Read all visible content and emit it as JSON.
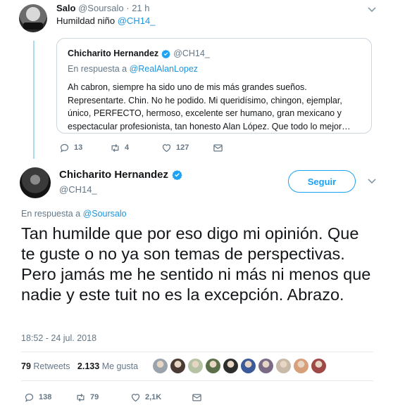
{
  "reply_tweet": {
    "author_name": "Salo",
    "author_handle": "@Soursalo",
    "age": "21 h",
    "text_prefix": "Humildad niño",
    "text_mention": "@CH14_",
    "actions": {
      "replies": "13",
      "retweets": "4",
      "likes": "127"
    }
  },
  "quoted_tweet": {
    "author_name": "Chicharito Hernandez",
    "author_handle": "@CH14_",
    "in_reply_label": "En respuesta a",
    "in_reply_mention": "@RealAlanLopez",
    "text": "Ah cabron, siempre ha sido uno de mis más grandes sueños. Representarte. Chin. No he podido. Mi queridísimo, chingon, ejemplar, único, PERFECTO, hermoso, excelente ser humano, gran mexicano y espectacular profesionista, tan honesto Alan López. Que todo lo mejor…"
  },
  "main_tweet": {
    "author_name": "Chicharito Hernandez",
    "author_handle": "@CH14_",
    "follow_label": "Seguir",
    "in_reply_label": "En respuesta a",
    "in_reply_mention": "@Soursalo",
    "text": "Tan humilde que por eso digo mi opinión. Que te guste o no ya son temas de perspectivas. Pero jamás me he sentido ni más ni menos que nadie y este tuit no es la excepción. Abrazo.",
    "timestamp": "18:52 - 24 jul. 2018",
    "retweets_count": "79",
    "retweets_label": "Retweets",
    "likes_count": "2.133",
    "likes_label": "Me gusta",
    "liker_colors": [
      "#9aa3ab",
      "#4a3b35",
      "#b6c2a4",
      "#5b6f4a",
      "#2d2d2d",
      "#3a5a9a",
      "#7a6a86",
      "#c9b9a8",
      "#d8a07a",
      "#a04848"
    ],
    "actions": {
      "replies": "138",
      "retweets": "79",
      "likes": "2,1K"
    }
  },
  "colors": {
    "accent": "#1da1f2",
    "link": "#1b95e0",
    "muted": "#657786",
    "thread": "#a8dced"
  }
}
